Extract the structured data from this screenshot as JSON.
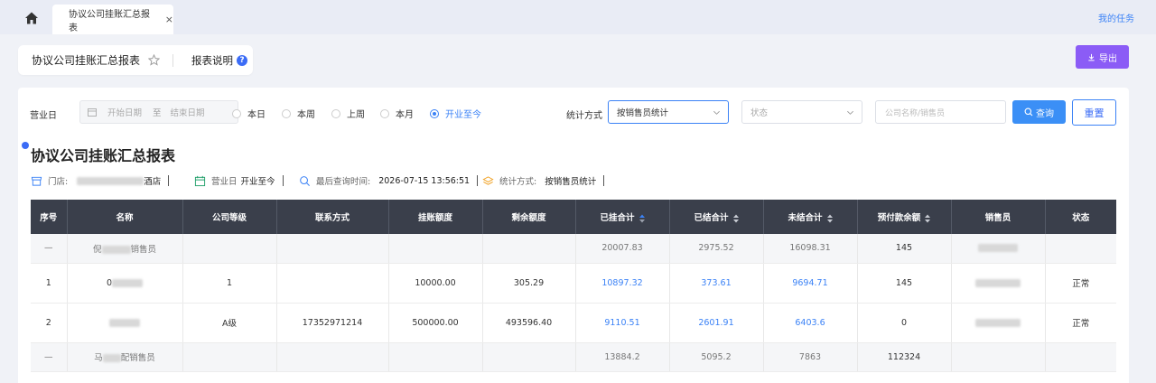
{
  "tabbar": {
    "tab_label": "协议公司挂账汇总报表",
    "close_symbol": "×",
    "my_task": "我的任务"
  },
  "header": {
    "title": "协议公司挂账汇总报表",
    "help_label": "报表说明",
    "help_symbol": "?",
    "export_label": "导出"
  },
  "filters": {
    "business_day_label": "营业日",
    "start_placeholder": "开始日期",
    "range_sep": "至",
    "end_placeholder": "结束日期",
    "periods": [
      "本日",
      "本周",
      "上周",
      "本月",
      "开业至今"
    ],
    "selected_period": "开业至今",
    "stat_label": "统计方式",
    "stat_value": "按销售员统计",
    "status_placeholder": "状态",
    "search_placeholder": "公司名称/销售员",
    "query_label": "查询",
    "reset_label": "重置"
  },
  "report": {
    "title": "协议公司挂账汇总报表",
    "store_label": "门店:",
    "store_suffix": "酒店",
    "day_label": "营业日",
    "day_value": "开业至今",
    "last_query_label": "最后查询时间:",
    "last_query_value": "2026-07-15 13:56:51",
    "stat_label": "统计方式:",
    "stat_value": "按销售员统计"
  },
  "table": {
    "columns": [
      "序号",
      "名称",
      "公司等级",
      "联系方式",
      "挂账额度",
      "剩余额度",
      "已挂合计",
      "已结合计",
      "未结合计",
      "预付款余额",
      "销售员",
      "状态"
    ],
    "rows": [
      {
        "type": "sub",
        "cells": [
          "—",
          "销售员",
          "",
          "",
          "",
          "",
          "20007.83",
          "2975.52",
          "16098.31",
          "145",
          "",
          ""
        ],
        "name_prefix": "倪"
      },
      {
        "type": "row",
        "cells": [
          "1",
          "",
          "1",
          "",
          "10000.00",
          "305.29",
          "10897.32",
          "373.61",
          "9694.71",
          "145",
          "",
          "正常"
        ],
        "name_prefix": "0"
      },
      {
        "type": "row",
        "cells": [
          "2",
          "",
          "A级",
          "17352971214",
          "500000.00",
          "493596.40",
          "9110.51",
          "2601.91",
          "6403.6",
          "0",
          "",
          "正常"
        ],
        "name_prefix": ""
      },
      {
        "type": "sub",
        "cells": [
          "—",
          "配销售员",
          "",
          "",
          "",
          "",
          "13884.2",
          "5095.2",
          "7863",
          "112324",
          "",
          ""
        ],
        "name_prefix": "马"
      }
    ]
  },
  "colors": {
    "accent": "#3b82f6",
    "export": "#8b5cf6",
    "table_header": "#3a3f4b"
  }
}
